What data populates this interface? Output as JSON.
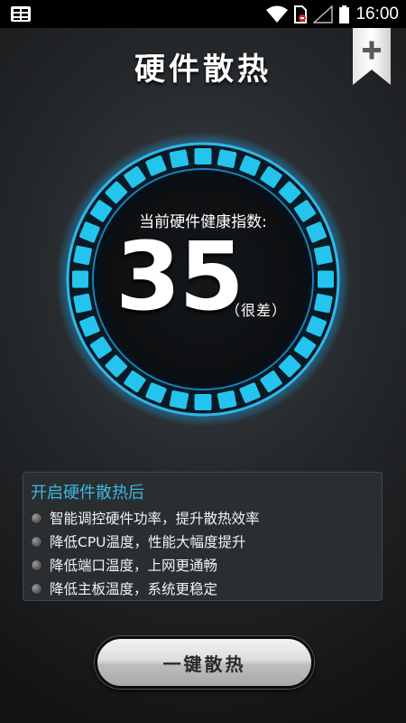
{
  "status_bar": {
    "time": "16:00",
    "left_icon": "bbm-notification-icon",
    "icons": [
      "wifi-icon",
      "sim-card-icon",
      "no-signal-icon",
      "battery-icon"
    ]
  },
  "header": {
    "title": "硬件散热",
    "add_icon": "plus-icon"
  },
  "gauge": {
    "label": "当前硬件健康指数:",
    "value": "35",
    "rating": "（很差）",
    "ring_color": "#24c4ee",
    "glow_color": "#1a9bd8"
  },
  "benefits": {
    "title": "开启硬件散热后",
    "items": [
      "智能调控硬件功率，提升散热效率",
      "降低CPU温度，性能大幅度提升",
      "降低端口温度，上网更通畅",
      "降低主板温度，系统更稳定"
    ]
  },
  "action": {
    "button_label": "一键散热"
  },
  "colors": {
    "accent": "#3ab8e0",
    "background": "#26292c"
  }
}
